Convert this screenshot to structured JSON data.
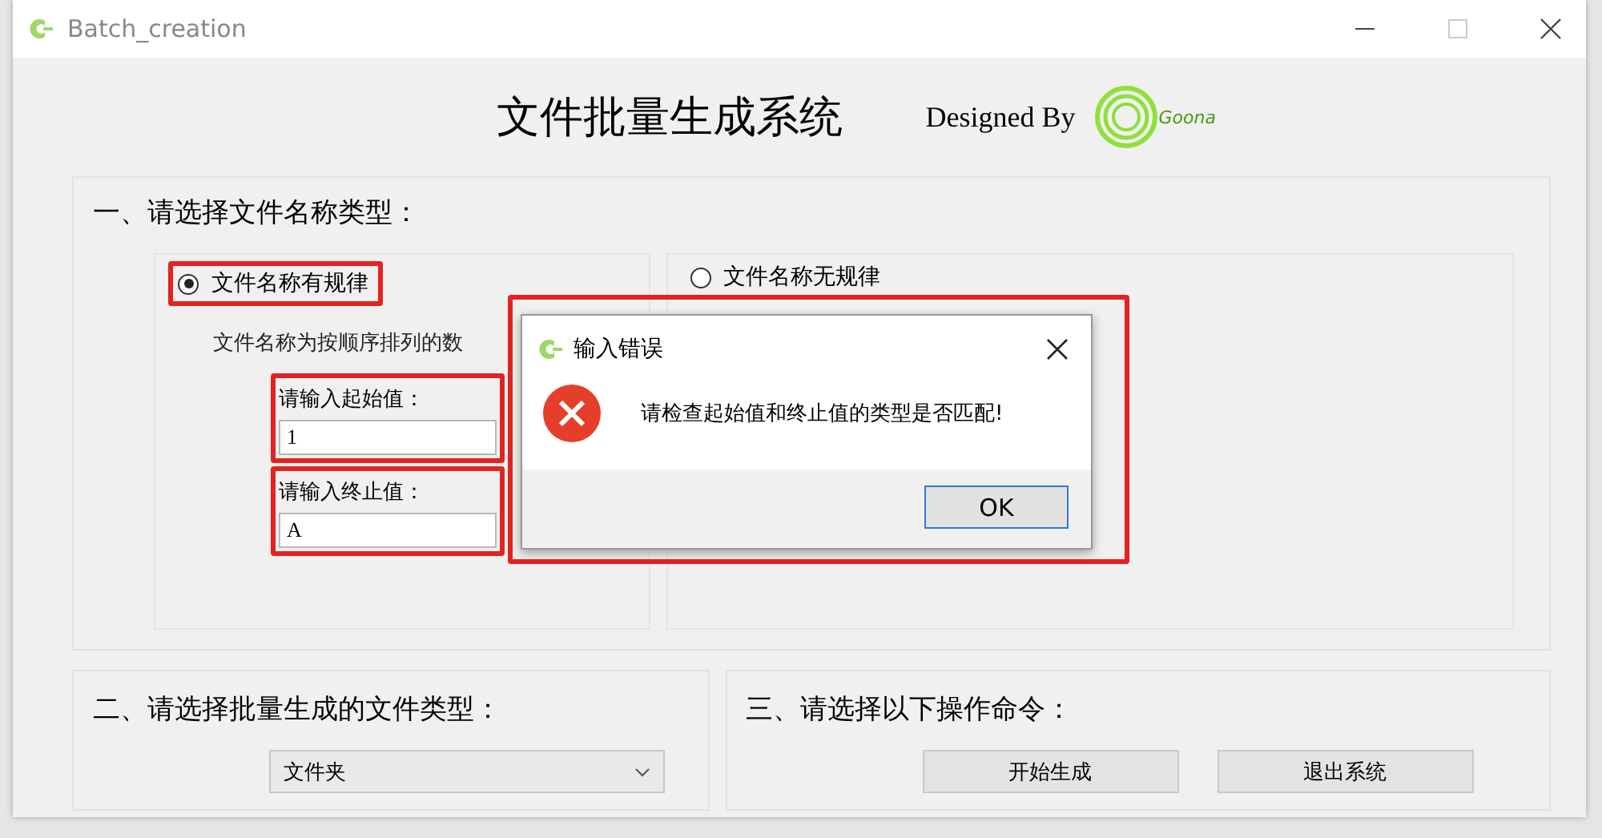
{
  "window": {
    "title": "Batch_creation"
  },
  "header": {
    "title": "文件批量生成系统",
    "credit": "Designed By",
    "logo_text": "Goona"
  },
  "section_1": {
    "heading": "一、请选择文件名称类型：",
    "options": [
      {
        "label": "文件名称有规律",
        "selected": true,
        "highlighted": true
      },
      {
        "label": "文件名称无规律",
        "selected": false,
        "highlighted": false
      }
    ],
    "description": "文件名称为按顺序排列的数",
    "fields": [
      {
        "label": "请输入起始值：",
        "value": "1",
        "highlighted": true
      },
      {
        "label": "请输入终止值：",
        "value": "A",
        "highlighted": true
      }
    ]
  },
  "section_2": {
    "heading": "二、请选择批量生成的文件类型：",
    "dropdown": {
      "value": "文件夹"
    }
  },
  "section_3": {
    "heading": "三、请选择以下操作命令：",
    "buttons": [
      "开始生成",
      "退出系统"
    ]
  },
  "dialog": {
    "title": "输入错误",
    "message": "请检查起始值和终止值的类型是否匹配!",
    "button": "OK",
    "highlighted": true
  }
}
